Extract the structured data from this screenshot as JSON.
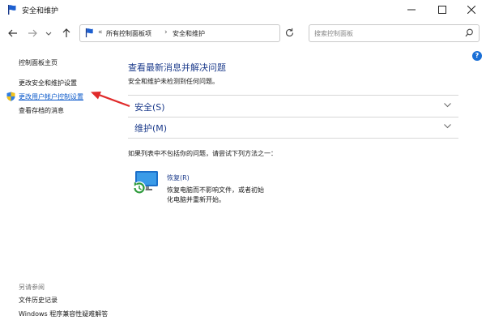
{
  "window": {
    "title": "安全和维护"
  },
  "address": {
    "crumbs": [
      "所有控制面板项",
      "安全和维护"
    ],
    "overflow": "«",
    "separator": "›"
  },
  "search": {
    "placeholder": "搜索控制面板"
  },
  "help": {
    "label": "?"
  },
  "sidebar": {
    "items": [
      {
        "label": "控制面板主页"
      },
      {
        "label": "更改安全和维护设置"
      },
      {
        "label": "更改用户帐户控制设置"
      },
      {
        "label": "查看存档的消息"
      }
    ],
    "see_also_title": "另请参阅",
    "see_also": [
      {
        "label": "文件历史记录"
      },
      {
        "label": "Windows 程序兼容性疑难解答"
      }
    ]
  },
  "main": {
    "title": "查看最新消息并解决问题",
    "subtitle": "安全和维护未检测到任何问题。",
    "sections": [
      {
        "label": "安全(S)"
      },
      {
        "label": "维护(M)"
      }
    ],
    "hint": "如果列表中不包括你的问题，请尝试下列方法之一：",
    "recovery": {
      "link": "恢复(R)",
      "desc_line1": "恢复电脑而不影响文件，或者初始",
      "desc_line2": "化电脑并重新开始。"
    }
  },
  "colors": {
    "link": "#1d3c8c",
    "accent": "#1a6fd6",
    "annotation_arrow": "#e02a2a"
  }
}
